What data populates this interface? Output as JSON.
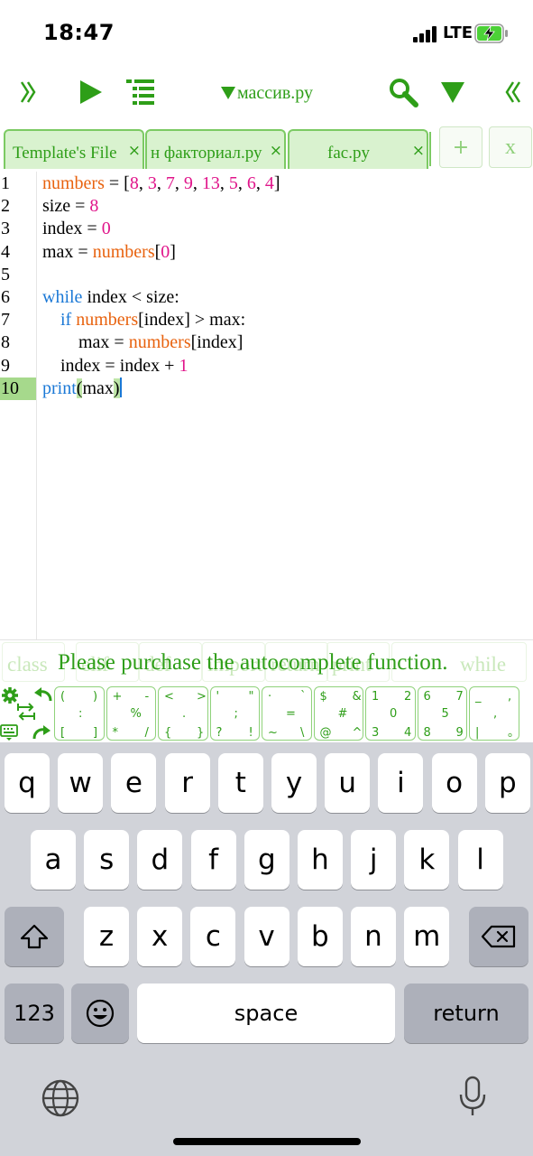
{
  "status": {
    "time": "18:47",
    "network": "LTE"
  },
  "toolbar": {
    "file_title": "массив.ру",
    "colors": {
      "accent": "#2e9e18",
      "tab_bg": "#d9f2cf"
    }
  },
  "tabs": [
    {
      "label": "Template's File",
      "close": "×"
    },
    {
      "label": "н факториал.ру",
      "close": "×"
    },
    {
      "label": "fac.py",
      "close": "×"
    }
  ],
  "tab_actions": {
    "add": "+",
    "close_all": "x"
  },
  "editor": {
    "active_line": 10,
    "lines": [
      {
        "n": "1",
        "tokens": [
          [
            "var",
            "numbers"
          ],
          [
            "txt",
            " = ["
          ],
          [
            "num",
            "8"
          ],
          [
            "txt",
            ", "
          ],
          [
            "num",
            "3"
          ],
          [
            "txt",
            ", "
          ],
          [
            "num",
            "7"
          ],
          [
            "txt",
            ", "
          ],
          [
            "num",
            "9"
          ],
          [
            "txt",
            ", "
          ],
          [
            "num",
            "13"
          ],
          [
            "txt",
            ", "
          ],
          [
            "num",
            "5"
          ],
          [
            "txt",
            ", "
          ],
          [
            "num",
            "6"
          ],
          [
            "txt",
            ", "
          ],
          [
            "num",
            "4"
          ],
          [
            "txt",
            "]"
          ]
        ]
      },
      {
        "n": "2",
        "tokens": [
          [
            "txt",
            "size = "
          ],
          [
            "num",
            "8"
          ]
        ]
      },
      {
        "n": "3",
        "tokens": [
          [
            "txt",
            "index = "
          ],
          [
            "num",
            "0"
          ]
        ]
      },
      {
        "n": "4",
        "tokens": [
          [
            "txt",
            "max = "
          ],
          [
            "var",
            "numbers"
          ],
          [
            "txt",
            "["
          ],
          [
            "num",
            "0"
          ],
          [
            "txt",
            "]"
          ]
        ]
      },
      {
        "n": "5",
        "tokens": []
      },
      {
        "n": "6",
        "tokens": [
          [
            "kw",
            "while"
          ],
          [
            "txt",
            " index < size:"
          ]
        ]
      },
      {
        "n": "7",
        "tokens": [
          [
            "txt",
            "    "
          ],
          [
            "kw",
            "if"
          ],
          [
            "txt",
            " "
          ],
          [
            "var",
            "numbers"
          ],
          [
            "txt",
            "[index] > max:"
          ]
        ]
      },
      {
        "n": "8",
        "tokens": [
          [
            "txt",
            "        max = "
          ],
          [
            "var",
            "numbers"
          ],
          [
            "txt",
            "[index]"
          ]
        ]
      },
      {
        "n": "9",
        "tokens": [
          [
            "txt",
            "    index = index + "
          ],
          [
            "num",
            "1"
          ]
        ]
      },
      {
        "n": "10",
        "tokens": [
          [
            "kw",
            "print"
          ],
          [
            "brk",
            "("
          ],
          [
            "txt",
            "max"
          ],
          [
            "brk",
            ")"
          ],
          [
            "cur",
            ""
          ]
        ]
      }
    ]
  },
  "autocomplete": {
    "words": [
      "class",
      "elif",
      "def",
      "import",
      "return",
      "print",
      "while"
    ],
    "message": "Please purchase the autocomplete function."
  },
  "symbol_keys": [
    [
      "(",
      ")",
      ":",
      "[",
      "]"
    ],
    [
      "+",
      "-",
      "%",
      "*",
      "/"
    ],
    [
      "<",
      ">",
      ".",
      "{",
      "}"
    ],
    [
      "'",
      "\"",
      ";",
      "?",
      "!"
    ],
    [
      "·",
      "`",
      "=",
      "~",
      "\\"
    ],
    [
      "$",
      "&",
      "#",
      "@",
      "^"
    ],
    [
      "1",
      "2",
      "0",
      "3",
      "4"
    ],
    [
      "6",
      "7",
      "5",
      "8",
      "9"
    ],
    [
      "_",
      ",",
      ",",
      "|",
      "。"
    ]
  ],
  "keyboard": {
    "row1": [
      "q",
      "w",
      "e",
      "r",
      "t",
      "y",
      "u",
      "i",
      "o",
      "p"
    ],
    "row2": [
      "a",
      "s",
      "d",
      "f",
      "g",
      "h",
      "j",
      "k",
      "l"
    ],
    "row3": [
      "z",
      "x",
      "c",
      "v",
      "b",
      "n",
      "m"
    ],
    "numbers_label": "123",
    "space_label": "space",
    "return_label": "return"
  }
}
